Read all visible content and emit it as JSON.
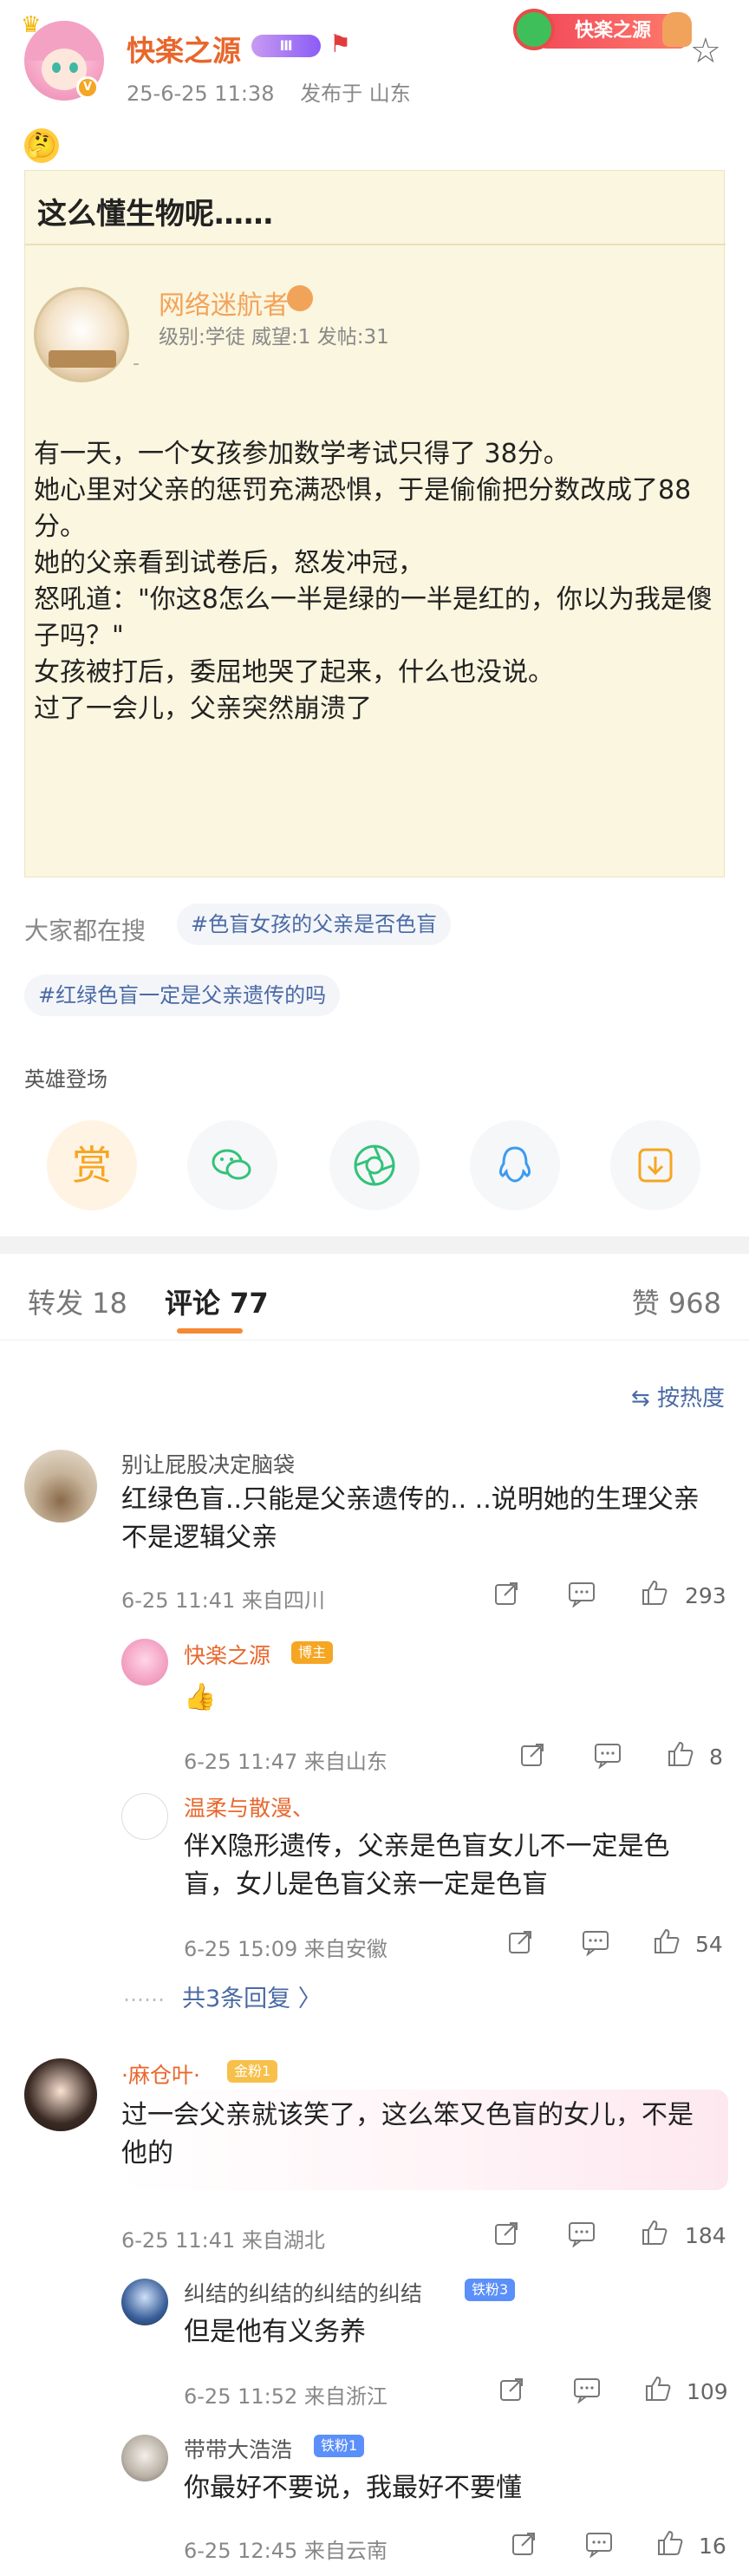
{
  "post": {
    "author": "快楽之源",
    "level": "Ⅲ",
    "date": "25-6-25 11:38",
    "location": "发布于 山东",
    "ribbon_text": "快楽之源",
    "emoji": "🤔"
  },
  "card": {
    "title": "这么懂生物呢……",
    "user": "网络迷航者",
    "user_stats": "级别:学徒  威望:1  发帖:31",
    "user_tick": "-",
    "body": [
      "有一天，一个女孩参加数学考试只得了 38分。",
      "她心里对父亲的惩罚充满恐惧，于是偷偷把分数改成了88分。",
      "她的父亲看到试卷后，怒发冲冠，",
      "怒吼道：\"你这8怎么一半是绿的一半是红的，你以为我是傻子吗？\"",
      "女孩被打后，委屈地哭了起来，什么也没说。",
      "过了一会儿，父亲突然崩溃了"
    ]
  },
  "search": {
    "label": "大家都在搜",
    "tags": [
      "#色盲女孩的父亲是否色盲",
      "#红绿色盲一定是父亲遗传的吗"
    ]
  },
  "hero": {
    "label": "英雄登场",
    "reward": "赏"
  },
  "tabs": {
    "repost": "转发 18",
    "comments": "评论 77",
    "likes": "赞 968"
  },
  "sort": "按热度",
  "comments": [
    {
      "name": "别让屁股决定脑袋",
      "text": "红绿色盲..只能是父亲遗传的..  ..说明她的生理父亲不是逻辑父亲",
      "meta": "6-25 11:41  来自四川",
      "likes": "293",
      "replies": [
        {
          "name": "快楽之源",
          "badge": "博主",
          "text": "👍",
          "meta": "6-25 11:47  来自山东",
          "likes": "8"
        },
        {
          "name": "温柔与散漫、",
          "text": "伴X隐形遗传，父亲是色盲女儿不一定是色盲，女儿是色盲父亲一定是色盲",
          "meta": "6-25 15:09  来自安徽",
          "likes": "54"
        }
      ],
      "more": "共3条回复 〉"
    },
    {
      "name": "·麻仓叶·",
      "badge": "金粉1",
      "text": "过一会父亲就该笑了，这么笨又色盲的女儿，不是他的",
      "meta": "6-25 11:41  来自湖北",
      "likes": "184",
      "replies": [
        {
          "name": "纠结的纠结的纠结的纠结",
          "badge": "铁粉3",
          "text": "但是他有义务养",
          "meta": "6-25 11:52  来自浙江",
          "likes": "109"
        },
        {
          "name": "带带大浩浩",
          "badge": "铁粉1",
          "text": "你最好不要说，我最好不要懂",
          "meta": "6-25 12:45  来自云南",
          "likes": "16"
        }
      ]
    }
  ],
  "colors": {
    "accent": "#f58a33",
    "link": "#4a6aa5",
    "author": "#e8672c"
  }
}
